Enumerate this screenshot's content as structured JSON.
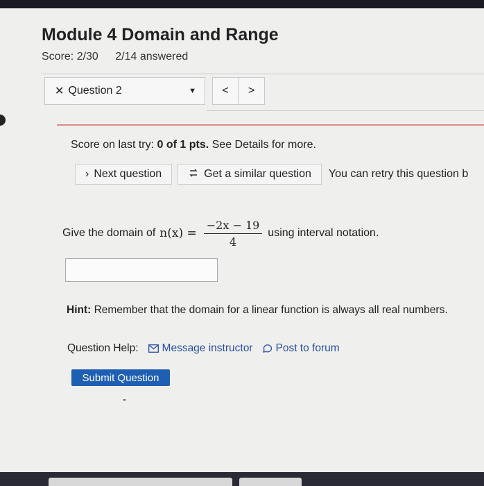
{
  "header": {
    "title": "Module 4 Domain and Range",
    "score": "Score: 2/30",
    "answered": "2/14 answered"
  },
  "question_nav": {
    "selected": "Question 2",
    "prev_label": "<",
    "next_label": ">"
  },
  "feedback": {
    "prefix": "Score on last try: ",
    "score": "0 of 1 pts.",
    "suffix": " See Details for more."
  },
  "actions": {
    "next_question": "Next question",
    "similar_question": "Get a similar question",
    "retry_text": "You can retry this question b"
  },
  "question": {
    "prefix": "Give the domain of ",
    "func": "n(x) =",
    "numerator": "−2x − 19",
    "denominator": "4",
    "suffix": "using interval notation."
  },
  "answer": {
    "value": ""
  },
  "hint": {
    "label": "Hint:",
    "text": " Remember that the domain for a linear function is always all real numbers."
  },
  "help": {
    "label": "Question Help:",
    "message_instructor": "Message instructor",
    "post_to_forum": "Post to forum"
  },
  "submit": {
    "label": "Submit Question"
  },
  "colors": {
    "accent": "#1f5fb3",
    "link": "#2b4fa3",
    "error_line": "#d88c8c"
  }
}
